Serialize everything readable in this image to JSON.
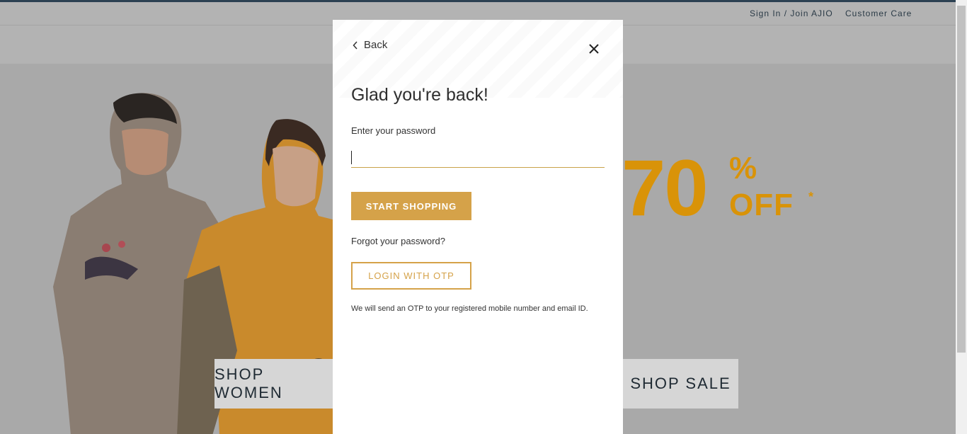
{
  "header": {
    "sign_in_label": "Sign In / Join AJIO",
    "customer_care_label": "Customer Care"
  },
  "hero": {
    "shop_women_label": "SHOP WOMEN",
    "shop_sale_label": "SHOP SALE",
    "promo_number": "70",
    "promo_percent": "%",
    "promo_off": "OFF",
    "promo_star": "*",
    "promo_color": "#d99308"
  },
  "modal": {
    "back_label": "Back",
    "close_icon": "close-icon",
    "title": "Glad you're back!",
    "password_label": "Enter your password",
    "password_value": "",
    "start_button_label": "START SHOPPING",
    "forgot_label": "Forgot your password?",
    "otp_button_label": "LOGIN WITH OTP",
    "otp_note": "We will send an OTP to your registered mobile number and email ID.",
    "accent_color": "#d5a249"
  }
}
